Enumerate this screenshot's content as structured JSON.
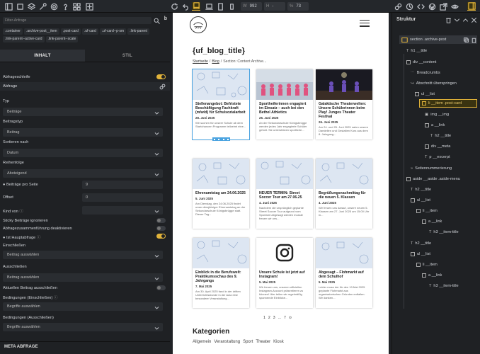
{
  "toolbar": {
    "width_label": "W",
    "width_value": "992",
    "height_label": "H",
    "height_value": "-",
    "zoom_label": "%",
    "zoom_value": "73"
  },
  "left_panel": {
    "search_placeholder": "Filter-Anfrage",
    "b_icon": "b",
    "classes": [
      ".container",
      ".archive-post__item",
      ".post-card",
      ".uf-card",
      ".uf-card--p-sm",
      ".link-parent",
      ".link-parent--active-card",
      ".link-parent--scale"
    ],
    "tabs": [
      {
        "label": "INHALT"
      },
      {
        "label": "STIL"
      }
    ],
    "query_loop_label": "Abfrageschleife",
    "query_label": "Abfrage",
    "type_label": "Typ",
    "type_value": "Beiträge",
    "post_type_label": "Beitragstyp",
    "post_type_value": "Beitrag",
    "order_by_label": "Sortieren nach",
    "order_by_value": "Datum",
    "order_label": "Reihenfolge",
    "order_value": "Absteigend",
    "per_page_label": "Beiträge pro Seite",
    "per_page_value": "9",
    "offset_label": "Offset",
    "offset_value": "0",
    "kind_label": "Kind von",
    "sticky_label": "Sticky Beiträge ignorieren",
    "merge_label": "Abfragezusammenführung deaktivieren",
    "main_query_label": "Ist Hauptabfrage",
    "include_label": "Einschließen",
    "include_placeholder": "Beitrag auswählen",
    "exclude_label": "Ausschließen",
    "exclude_placeholder": "Beitrag auswählen",
    "exclude_current_label": "Aktuellen Beitrag ausschließen",
    "cond_include_label": "Bedingungen (Einschließen)",
    "cond_include_placeholder": "Begriffe auswählen",
    "cond_exclude_label": "Bedingungen (Ausschließen)",
    "cond_exclude_placeholder": "Begriffe auswählen",
    "meta_header": "META ABFRAGE"
  },
  "page": {
    "title": "{uf_blog_title}",
    "breadcrumb_home": "Startseite",
    "breadcrumb_sep": "/",
    "breadcrumb_blog": "Blog",
    "breadcrumb_current": "Section: Content Archive...",
    "cards": [
      {
        "title": "Stellenangebot: Befristete Beschäftigung Fachkraft (m/w/d) für Schulsozialarbeit",
        "date": "28. Juni 2025",
        "excerpt": "Wir suchen für unsere Schule ab dem Startchancen Programm teilzeimt eine..."
      },
      {
        "title": "Sportheiferinnen engagiert im Einsatz – auch bei den Bethel Athletics",
        "date": "25. Juni 2025",
        "excerpt": "An der Sekundarschule Königsbrügge werden jedes Jahr engagierte Schüler geholt. Sie unterstützen sportliche..."
      },
      {
        "title": "Galaktische Theaterwelten: Unsere Schülerinnen beim Play! Junges Theater Festival",
        "date": "26. Juni 2025",
        "excerpt": "Am 24. und 25. Juni 2025 nahm unsere Darstellen und Gestalten Kurs aus dem 8. Jahrgang..."
      },
      {
        "title": "Ehrenamtstag am 24.06.2025",
        "date": "5. Juni 2025",
        "excerpt": "Am Dienstag, den 24.06.2025 findet unser diesjähriger Ehrenamtstag an der Sekundarschule Königsbrügge statt. Dieser Tag..."
      },
      {
        "title": "NEUER TERMIN: Street Soccer Tour am 27.06.25",
        "date": "4. Juni 2025",
        "excerpt": "Nachdem die ursprünglich geplante Street Soccer Tour aufgrund vom Sportamt abgesagt werden musste freuen wir uns..."
      },
      {
        "title": "Begrüßungsnachmittag für die neuen 5. Klassen",
        "date": "4. Juni 2025",
        "excerpt": "Wir freuen uns darauf, unsere neuen 5. Klassen am 27. Juni 2025 um 15:00 Uhr in..."
      },
      {
        "title": "Einblick in die Berufswelt: Praktikumsschau des 9. Jahrgangs",
        "date": "7. Mai 2025",
        "excerpt": "Am 30. April 2025 fand in der dritten Unterrichtsstunde in der Aula eine besondere Veranstaltung..."
      },
      {
        "title": "Unsere Schule ist jetzt auf Instagram!",
        "date": "5. Mai 2025",
        "excerpt": "Wir freuen uns, unseren offiziellen Instagram-Account präsentieren zu können! Hier teilen wir regelmäßig spannende Einblicke..."
      },
      {
        "title": "Abgesagt – Flohmarkt auf dem Schulhof",
        "date": "5. Mai 2025",
        "excerpt": "Leider muss der für den 10.Mai 2025 geplante Flohmarkt aus organisatorischen Gründen entfallen. Wir danken..."
      }
    ],
    "pagination": [
      "1",
      "2",
      "3",
      "...",
      "7"
    ],
    "categories_title": "Kategorien",
    "categories": [
      "Allgemein",
      "Veranstaltung",
      "Sport",
      "Theater",
      "Kiosk"
    ]
  },
  "structure": {
    "title": "Struktur",
    "nodes": [
      {
        "label": "section .archive-post"
      },
      {
        "label": "h1 __title"
      },
      {
        "label": "div __content"
      },
      {
        "label": "Breadcrumbs"
      },
      {
        "label": "Abschnitt überspringen"
      },
      {
        "label": "ul __list"
      },
      {
        "label": "li __item .post-card"
      },
      {
        "label": "img __img"
      },
      {
        "label": "a __link"
      },
      {
        "label": "h2 __title"
      },
      {
        "label": "div __meta"
      },
      {
        "label": "p __excerpt"
      },
      {
        "label": "Seitennummerierung"
      },
      {
        "label": "aside __aside .aside-menu"
      },
      {
        "label": "h2 __title"
      },
      {
        "label": "ul __list"
      },
      {
        "label": "li __item"
      },
      {
        "label": "a __link"
      },
      {
        "label": "h3 __item-title"
      },
      {
        "label": "h2 __title"
      },
      {
        "label": "ul __list"
      },
      {
        "label": "li __item"
      },
      {
        "label": "a __link"
      },
      {
        "label": "h3 __item-title"
      }
    ]
  }
}
